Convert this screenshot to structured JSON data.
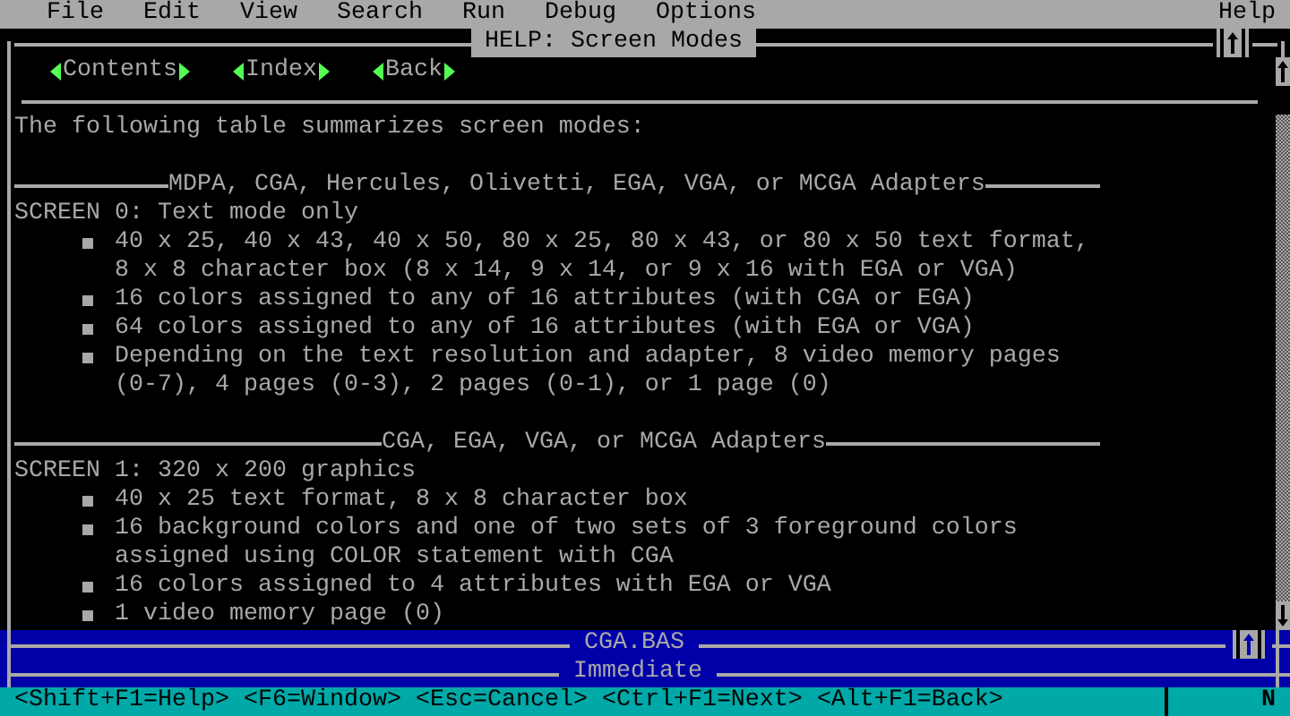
{
  "menu_bar": {
    "items": [
      "File",
      "Edit",
      "View",
      "Search",
      "Run",
      "Debug",
      "Options"
    ],
    "help": "Help"
  },
  "help_window": {
    "title": "HELP: Screen Modes",
    "nav_links": [
      "Contents",
      "Index",
      "Back"
    ],
    "lines": [
      {
        "kind": "text",
        "text": "The following table summarizes screen modes:"
      },
      {
        "kind": "blank"
      },
      {
        "kind": "heading",
        "text": "MDPA, CGA, Hercules, Olivetti, EGA, VGA, or MCGA Adapters"
      },
      {
        "kind": "text",
        "text": "SCREEN 0: Text mode only"
      },
      {
        "kind": "bullet",
        "text": "40 x 25, 40 x 43, 40 x 50, 80 x 25, 80 x 43, or 80 x 50 text format,"
      },
      {
        "kind": "continuation",
        "text": "8 x 8 character box (8 x 14, 9 x 14, or 9 x 16 with EGA or VGA)"
      },
      {
        "kind": "bullet",
        "text": "16 colors assigned to any of 16 attributes (with CGA or EGA)"
      },
      {
        "kind": "bullet",
        "text": "64 colors assigned to any of 16 attributes (with EGA or VGA)"
      },
      {
        "kind": "bullet",
        "text": "Depending on the text resolution and adapter, 8 video memory pages"
      },
      {
        "kind": "continuation",
        "text": "(0-7), 4 pages (0-3), 2 pages (0-1), or 1 page (0)"
      },
      {
        "kind": "blank"
      },
      {
        "kind": "heading",
        "text": "CGA, EGA, VGA, or MCGA Adapters"
      },
      {
        "kind": "text",
        "text": "SCREEN 1: 320 x 200 graphics"
      },
      {
        "kind": "bullet",
        "text": "40 x 25 text format, 8 x 8 character box"
      },
      {
        "kind": "bullet",
        "text": "16 background colors and one of two sets of 3 foreground colors"
      },
      {
        "kind": "continuation",
        "text": "assigned using COLOR statement with CGA"
      },
      {
        "kind": "bullet",
        "text": "16 colors assigned to 4 attributes with EGA or VGA"
      },
      {
        "kind": "bullet",
        "text": "1 video memory page (0)"
      }
    ]
  },
  "editor_window": {
    "title": "CGA.BAS"
  },
  "immediate_window": {
    "title": "Immediate"
  },
  "status_bar": {
    "hints": [
      "<Shift+F1=Help>",
      "<F6=Window>",
      "<Esc=Cancel>",
      "<Ctrl+F1=Next>",
      "<Alt+F1=Back>"
    ],
    "indicator": "N"
  }
}
